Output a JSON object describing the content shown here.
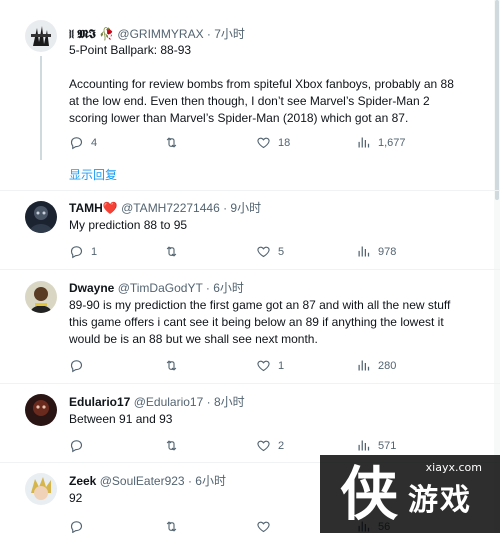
{
  "tweets": [
    {
      "name": "⧘⧙ 𝕸𝕴 🥀",
      "handle": "@GRIMMYRAX",
      "time": "· 7小时",
      "lines": [
        "5-Point Ballpark: 88-93",
        "",
        "Accounting for review bombs from spiteful Xbox fanboys, probably an 88",
        "at the low end. Even then though, I don’t see Marvel’s Spider-Man 2",
        "scoring lower than Marvel’s Spider-Man (2018) which got an 87."
      ],
      "replies": "4",
      "retweets": "",
      "likes": "18",
      "views": "1,677"
    },
    {
      "name": "TAMH❤️",
      "handle": "@TAMH72271446",
      "time": "· 9小时",
      "lines": [
        "My prediction 88 to 95"
      ],
      "replies": "1",
      "retweets": "",
      "likes": "5",
      "views": "978"
    },
    {
      "name": "Dwayne",
      "handle": "@TimDaGodYT",
      "time": "· 6小时",
      "lines": [
        "89-90 is my prediction the first game got an 87 and with all the new stuff",
        "this game offers i cant see it being below an 89 if anything the lowest it",
        "would be is an 88 but we shall see next month."
      ],
      "replies": "",
      "retweets": "",
      "likes": "1",
      "views": "280"
    },
    {
      "name": "Edulario17",
      "handle": "@Edulario17",
      "time": "· 8小时",
      "lines": [
        "Between 91 and 93"
      ],
      "replies": "",
      "retweets": "",
      "likes": "2",
      "views": "571"
    },
    {
      "name": "Zeek",
      "handle": "@SoulEater923",
      "time": "· 6小时",
      "lines": [
        "92"
      ],
      "replies": "",
      "retweets": "",
      "likes": "",
      "views": "56"
    }
  ],
  "show_replies": "显示回复",
  "watermark": {
    "url": "xiayx.com",
    "big": "侠",
    "small": "游戏"
  },
  "colors": {
    "accent": "#1d9bf0",
    "muted": "#536471",
    "text": "#0f1419"
  },
  "icons": [
    "reply-icon",
    "retweet-icon",
    "like-icon",
    "views-icon"
  ]
}
